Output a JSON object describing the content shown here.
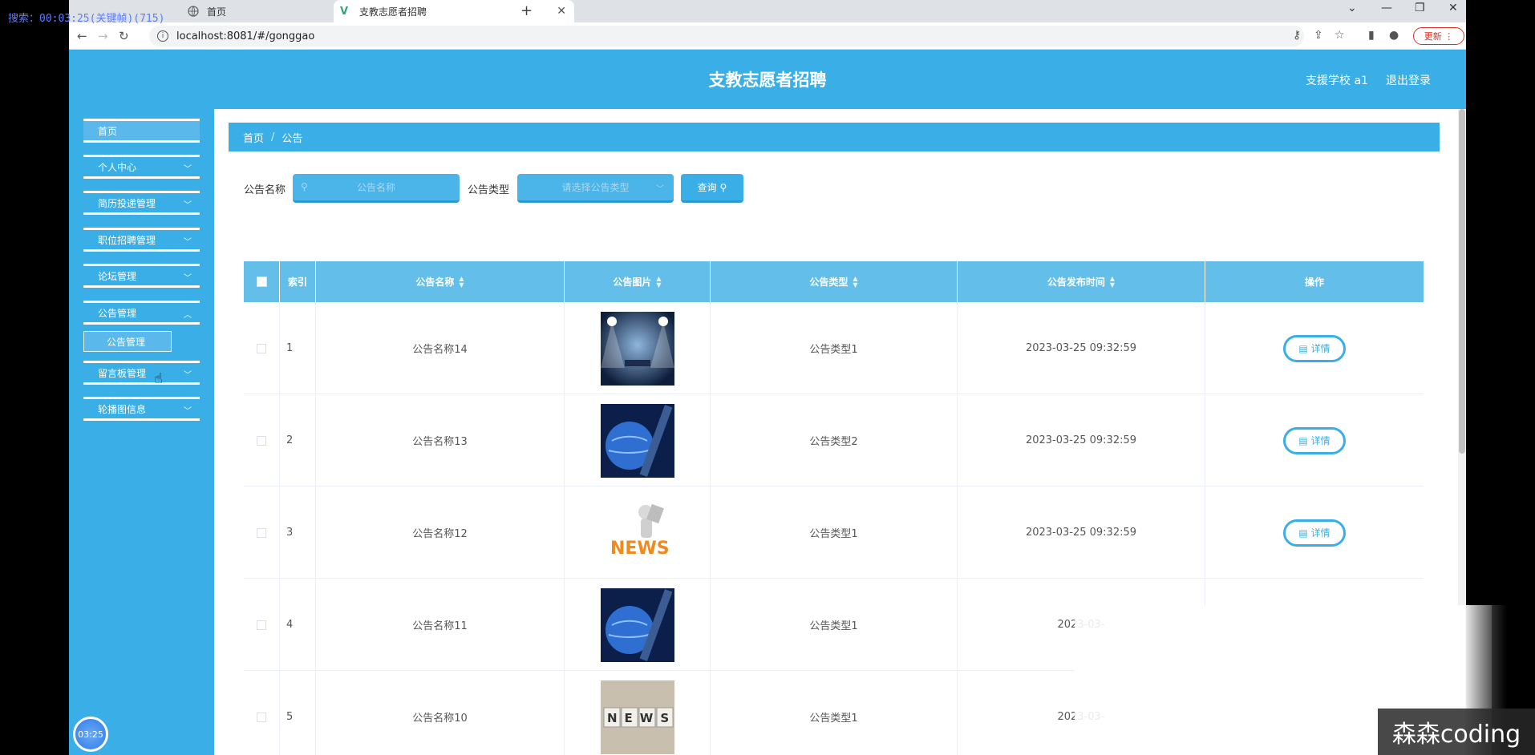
{
  "recorder": {
    "overlay_text": "搜索：00:03:25(关键帧)(715)",
    "timer": "03:25",
    "watermark": "森森coding"
  },
  "browser": {
    "tabs": [
      {
        "label": "首页"
      },
      {
        "label": "支教志愿者招聘"
      }
    ],
    "url": "localhost:8081/#/gonggao",
    "update_label": "更新"
  },
  "header": {
    "title": "支教志愿者招聘",
    "user": "支援学校 a1",
    "logout": "退出登录"
  },
  "sidebar": {
    "items": [
      {
        "label": "首页"
      },
      {
        "label": "个人中心"
      },
      {
        "label": "简历投递管理"
      },
      {
        "label": "职位招聘管理"
      },
      {
        "label": "论坛管理"
      },
      {
        "label": "公告管理"
      },
      {
        "label": "留言板管理"
      },
      {
        "label": "轮播图信息"
      }
    ],
    "submenu_label": "公告管理"
  },
  "breadcrumb": {
    "home": "首页",
    "sep": "/",
    "current": "公告"
  },
  "search": {
    "name_label": "公告名称",
    "name_placeholder": "公告名称",
    "type_label": "公告类型",
    "type_placeholder": "请选择公告类型",
    "query_label": "查询"
  },
  "table": {
    "headers": [
      "索引",
      "公告名称",
      "公告图片",
      "公告类型",
      "公告发布时间",
      "操作"
    ],
    "detail_label": "详情",
    "rows": [
      {
        "index": "1",
        "name": "公告名称14",
        "image": "stage-lights",
        "type": "公告类型1",
        "time": "2023-03-25 09:32:59"
      },
      {
        "index": "2",
        "name": "公告名称13",
        "image": "globe-news",
        "type": "公告类型2",
        "time": "2023-03-25 09:32:59"
      },
      {
        "index": "3",
        "name": "公告名称12",
        "image": "news-figure",
        "type": "公告类型1",
        "time": "2023-03-25 09:32:59"
      },
      {
        "index": "4",
        "name": "公告名称11",
        "image": "globe-news",
        "type": "公告类型1",
        "time": "2023-03-"
      },
      {
        "index": "5",
        "name": "公告名称10",
        "image": "news-cubes",
        "type": "公告类型1",
        "time": "2023-03-"
      }
    ]
  },
  "colors": {
    "primary": "#3aaee6",
    "header_row": "#63bfe9"
  }
}
